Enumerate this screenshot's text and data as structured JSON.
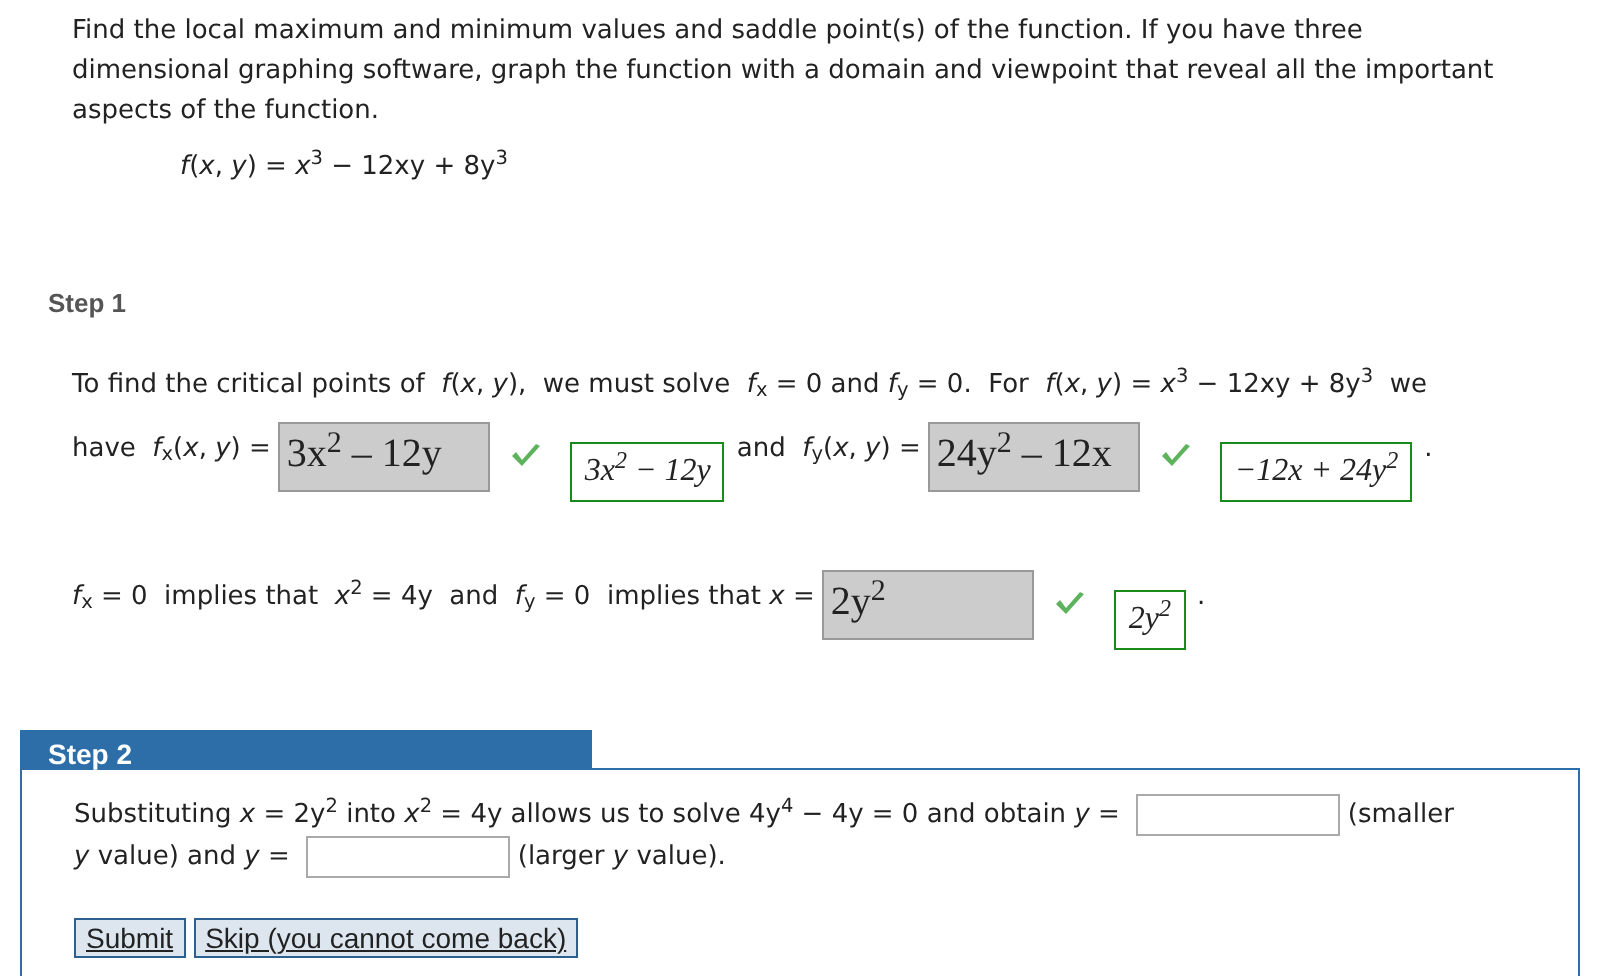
{
  "problem": {
    "text": "Find the local maximum and minimum values and saddle point(s) of the function. If you have three dimensional graphing software, graph the function with a domain and viewpoint that reveal all the important aspects of the function.",
    "function": "*f*(*x*, *y*) = *x*$^{3}$ − 12xy + 8y$^{3}$"
  },
  "step1": {
    "title": "Step 1",
    "paragraphs": [
      {
        "parts": [
          {
            "kind": "text",
            "text": "To find the critical points of  *f*(*x*, *y*),  we must solve  *f*$_{x}$ = 0 and *f*$_{y}$ = 0.  For  *f*(*x*, *y*) = *x*$^{3}$ − 12xy + 8y$^{3}$  we"
          }
        ]
      },
      {
        "parts": [
          {
            "kind": "text",
            "text": "have  *f*$_{x}$(*x*, *y*) ="
          },
          {
            "kind": "answer",
            "value": "3x$^{2}$ – 12y",
            "correct": true
          },
          {
            "kind": "solution",
            "text": "3x$^{2}$ − 12y"
          },
          {
            "kind": "text",
            "text": "and  *f*$_{y}$(*x*, *y*) ="
          },
          {
            "kind": "answer",
            "value": "24y$^{2}$ – 12x",
            "correct": true
          },
          {
            "kind": "solution",
            "text": "−12x + 24y$^{2}$"
          },
          {
            "kind": "text",
            "text": "."
          }
        ]
      },
      {
        "parts": [
          {
            "kind": "text",
            "text": "*f*$_{x}$ = 0  implies that  *x*$^{2}$ = 4y  and  *f*$_{y}$ = 0  implies that *x* ="
          },
          {
            "kind": "answer",
            "value": "2y$^{2}$",
            "correct": true
          },
          {
            "kind": "solution",
            "text": "2y$^{2}$"
          },
          {
            "kind": "text",
            "text": "."
          }
        ]
      }
    ]
  },
  "step2": {
    "title": "Step 2",
    "parts": [
      {
        "kind": "text",
        "text": "Substituting  *x* = 2y$^{2}$  into  *x*$^{2}$ = 4y  allows us to solve  4y$^{4}$ − 4y = 0  and obtain *y* ="
      },
      {
        "kind": "input"
      },
      {
        "kind": "text",
        "text": "(smaller"
      },
      {
        "kind": "text",
        "text": "*y* value) and *y* ="
      },
      {
        "kind": "input"
      },
      {
        "kind": "text",
        "text": "(larger *y* value)."
      }
    ],
    "buttons": [
      "Submit",
      "Skip (you cannot come back)"
    ]
  }
}
